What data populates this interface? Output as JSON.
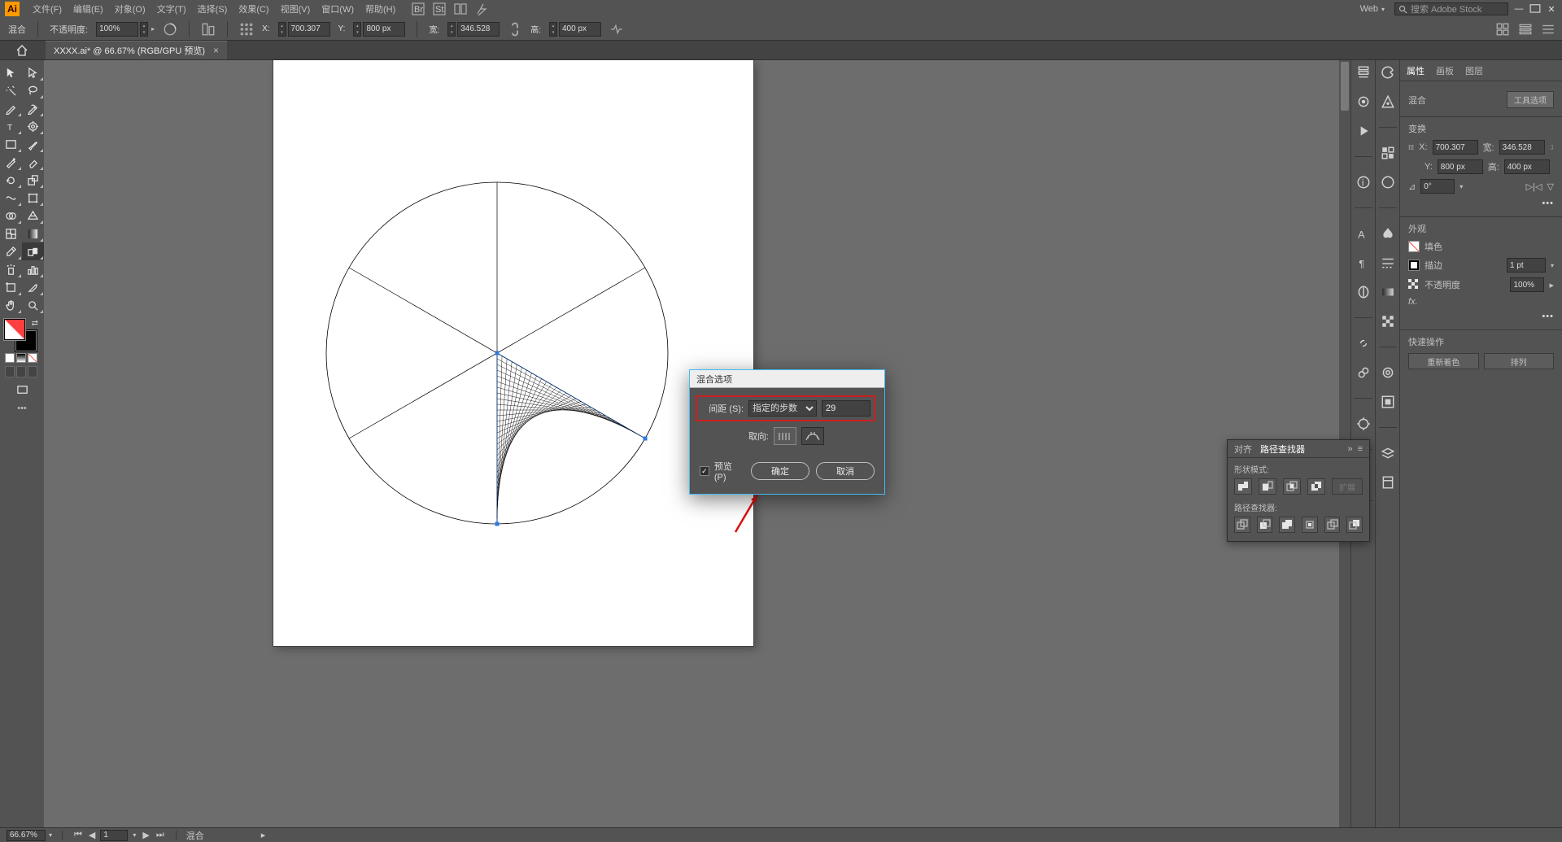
{
  "menu": {
    "file": "文件(F)",
    "edit": "编辑(E)",
    "object": "对象(O)",
    "type": "文字(T)",
    "select": "选择(S)",
    "effect": "效果(C)",
    "view": "视图(V)",
    "window": "窗口(W)",
    "help": "帮助(H)"
  },
  "workspace": {
    "label": "Web"
  },
  "search": {
    "placeholder": "搜索 Adobe Stock"
  },
  "control": {
    "object_label": "混合",
    "opacity_label": "不透明度:",
    "opacity_value": "100%",
    "x_label": "X:",
    "x_value": "700.307",
    "y_label": "Y:",
    "y_value": "800 px",
    "w_label": "宽:",
    "w_value": "346.528",
    "h_label": "高:",
    "h_value": "400 px"
  },
  "tab": {
    "title": "XXXX.ai* @ 66.67% (RGB/GPU 预览)"
  },
  "props": {
    "tab_properties": "属性",
    "tab_artboards": "画板",
    "tab_layers": "图层",
    "object_type": "混合",
    "tool_options": "工具选项",
    "transform_label": "变换",
    "x": "700.307",
    "y": "800 px",
    "w": "346.528",
    "h": "400 px",
    "angle": "0°",
    "appearance_label": "外观",
    "fill_label": "填色",
    "stroke_label": "描边",
    "stroke_val": "1 pt",
    "opacity_label": "不透明度",
    "opacity_val": "100%",
    "quick_label": "快速操作",
    "recolor": "重新着色",
    "arrange": "排列"
  },
  "pf": {
    "tab_align": "对齐",
    "tab_pathfinder": "路径查找器",
    "shape_mode": "形状模式:",
    "pathfinder": "路径查找器:",
    "expand": "扩展"
  },
  "dialog": {
    "title": "混合选项",
    "spacing_label": "间距 (S):",
    "spacing_option": "指定的步数",
    "spacing_value": "29",
    "orient_label": "取向:",
    "preview": "预览 (P)",
    "ok": "确定",
    "cancel": "取消"
  },
  "status": {
    "zoom": "66.67%",
    "artboard": "1",
    "tool": "混合"
  }
}
